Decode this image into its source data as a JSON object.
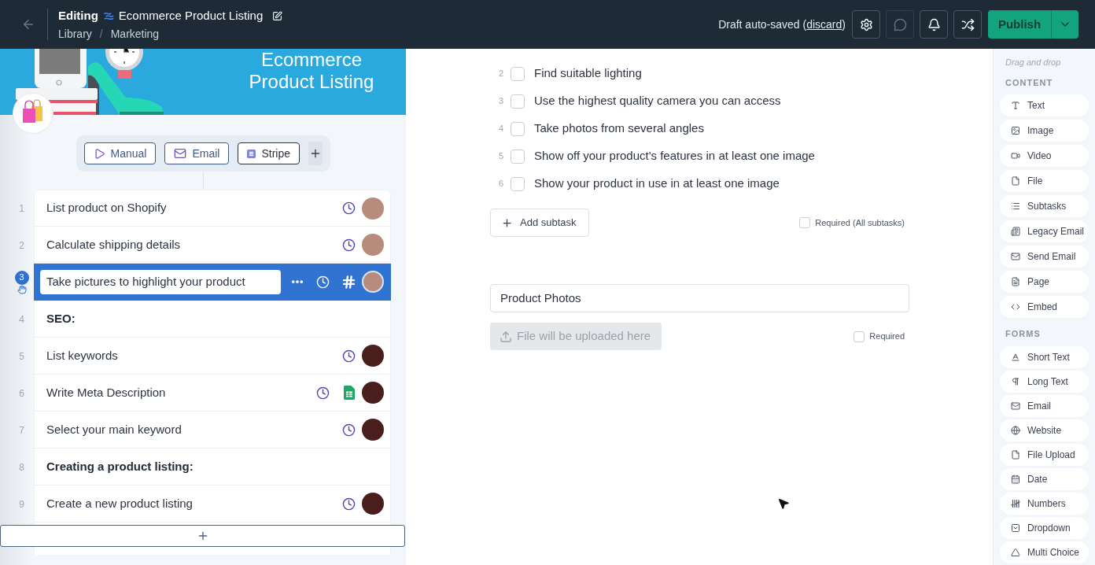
{
  "header": {
    "mode": "Editing",
    "title": "Ecommerce Product Listing",
    "breadcrumbs": [
      "Library",
      "Marketing"
    ],
    "breadcrumb_separator": "/",
    "save_status": {
      "before": "Draft auto-saved (",
      "link": "discard",
      "after": ")"
    },
    "tool_buttons": [
      {
        "kind": "settings",
        "disabled": false
      },
      {
        "kind": "comments",
        "disabled": true
      },
      {
        "kind": "reminders",
        "disabled": false
      },
      {
        "kind": "shuffle",
        "disabled": false
      }
    ],
    "publish_button": "Publish"
  },
  "banner": {
    "title": "Ecommerce Product Listing"
  },
  "triggers": [
    {
      "kind": "manual",
      "label": "Manual"
    },
    {
      "kind": "email",
      "label": "Email"
    },
    {
      "kind": "stripe",
      "label": "Stripe"
    }
  ],
  "tasks": [
    {
      "number": "1",
      "kind": "task",
      "title": "List product on Shopify",
      "selected": false,
      "assignee": {
        "color": "#b88c7c"
      }
    },
    {
      "number": "2",
      "kind": "task",
      "title": "Calculate shipping details",
      "selected": false,
      "assignee": {
        "color": "#b88c7c"
      }
    },
    {
      "number": "3",
      "kind": "task",
      "title": "Take pictures to highlight your product",
      "selected": true,
      "attachment": {
        "kind": "hash"
      },
      "assignee": {
        "color": "#b88c7c"
      }
    },
    {
      "number": "4",
      "kind": "heading",
      "title": "SEO:",
      "selected": false
    },
    {
      "number": "5",
      "kind": "task",
      "title": "List keywords",
      "selected": false,
      "assignee": {
        "color": "#4b1e1e"
      }
    },
    {
      "number": "6",
      "kind": "task",
      "title": "Write Meta Description",
      "selected": false,
      "attachment": {
        "kind": "spreadsheet"
      },
      "assignee": {
        "color": "#4b1e1e"
      }
    },
    {
      "number": "7",
      "kind": "task",
      "title": "Select your main keyword",
      "selected": false,
      "assignee": {
        "color": "#4b1e1e"
      }
    },
    {
      "number": "8",
      "kind": "heading",
      "title": "Creating a product listing:",
      "selected": false
    },
    {
      "number": "9",
      "kind": "task",
      "title": "Create a new product listing",
      "selected": false,
      "assignee": {
        "color": "#4b1e1e"
      }
    }
  ],
  "subtasks": [
    {
      "number": "2",
      "label": "Find suitable lighting",
      "checked": false
    },
    {
      "number": "3",
      "label": "Use the highest quality camera you can access",
      "checked": false
    },
    {
      "number": "4",
      "label": "Take photos from several angles",
      "checked": false
    },
    {
      "number": "5",
      "label": "Show off your product's features in at least one image",
      "checked": false
    },
    {
      "number": "6",
      "label": "Show your product in use in at least one image",
      "checked": false
    }
  ],
  "add_subtask_button": "Add subtask",
  "subtasks_required": {
    "label": "Required (All subtasks)",
    "checked": false
  },
  "file_upload": {
    "title": "Product Photos",
    "button": {
      "label": "File will be uploaded here",
      "disabled": true
    },
    "required": {
      "label": "Required",
      "checked": false
    }
  },
  "sidebar": {
    "hint": "Drag and drop",
    "sections": [
      {
        "title": "CONTENT",
        "items": [
          {
            "kind": "text",
            "label": "Text"
          },
          {
            "kind": "image",
            "label": "Image"
          },
          {
            "kind": "video",
            "label": "Video"
          },
          {
            "kind": "file",
            "label": "File"
          },
          {
            "kind": "subtasks",
            "label": "Subtasks"
          },
          {
            "kind": "legacy_email",
            "label": "Legacy Email"
          },
          {
            "kind": "send_email",
            "label": "Send Email"
          },
          {
            "kind": "page",
            "label": "Page"
          },
          {
            "kind": "embed",
            "label": "Embed"
          }
        ]
      },
      {
        "title": "FORMS",
        "items": [
          {
            "kind": "short_text",
            "label": "Short Text"
          },
          {
            "kind": "long_text",
            "label": "Long Text"
          },
          {
            "kind": "email",
            "label": "Email"
          },
          {
            "kind": "website",
            "label": "Website"
          },
          {
            "kind": "file_upload",
            "label": "File Upload"
          },
          {
            "kind": "date",
            "label": "Date"
          },
          {
            "kind": "numbers",
            "label": "Numbers"
          },
          {
            "kind": "dropdown",
            "label": "Dropdown"
          },
          {
            "kind": "multi_choice",
            "label": "Multi Choice"
          }
        ]
      }
    ]
  }
}
